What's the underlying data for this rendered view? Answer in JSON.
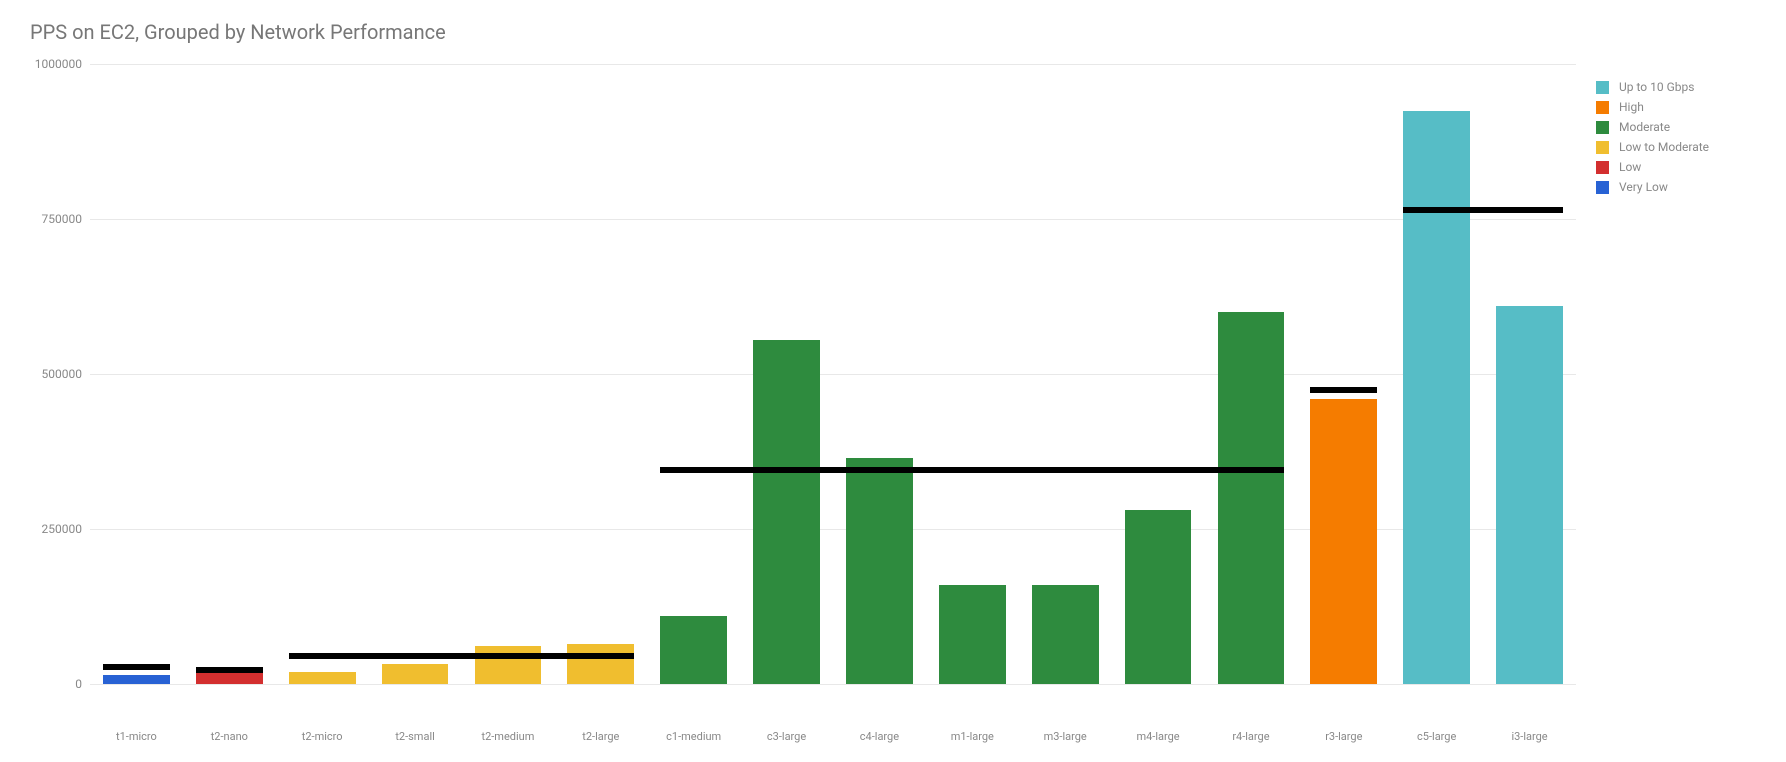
{
  "chart_data": {
    "type": "bar",
    "title": "PPS on EC2, Grouped by Network Performance",
    "ylabel": "",
    "xlabel": "",
    "ylim": [
      0,
      1000000
    ],
    "y_ticks": [
      0,
      250000,
      500000,
      750000,
      1000000
    ],
    "categories": [
      "t1-micro",
      "t2-nano",
      "t2-micro",
      "t2-small",
      "t2-medium",
      "t2-large",
      "c1-medium",
      "c3-large",
      "c4-large",
      "m1-large",
      "m3-large",
      "m4-large",
      "r4-large",
      "r3-large",
      "c5-large",
      "i3-large"
    ],
    "bars": [
      {
        "label": "t1-micro",
        "value": 15000,
        "group": "Very Low"
      },
      {
        "label": "t2-nano",
        "value": 17000,
        "group": "Low"
      },
      {
        "label": "t2-micro",
        "value": 20000,
        "group": "Low to Moderate"
      },
      {
        "label": "t2-small",
        "value": 32000,
        "group": "Low to Moderate"
      },
      {
        "label": "t2-medium",
        "value": 62000,
        "group": "Low to Moderate"
      },
      {
        "label": "t2-large",
        "value": 65000,
        "group": "Low to Moderate"
      },
      {
        "label": "c1-medium",
        "value": 110000,
        "group": "Moderate"
      },
      {
        "label": "c3-large",
        "value": 555000,
        "group": "Moderate"
      },
      {
        "label": "c4-large",
        "value": 365000,
        "group": "Moderate"
      },
      {
        "label": "m1-large",
        "value": 160000,
        "group": "Moderate"
      },
      {
        "label": "m3-large",
        "value": 160000,
        "group": "Moderate"
      },
      {
        "label": "m4-large",
        "value": 280000,
        "group": "Moderate"
      },
      {
        "label": "r4-large",
        "value": 600000,
        "group": "Moderate"
      },
      {
        "label": "r3-large",
        "value": 460000,
        "group": "High"
      },
      {
        "label": "c5-large",
        "value": 925000,
        "group": "Up to 10 Gbps"
      },
      {
        "label": "i3-large",
        "value": 610000,
        "group": "Up to 10 Gbps"
      }
    ],
    "group_averages": [
      {
        "group": "Very Low",
        "avg": 27000,
        "start_idx": 0,
        "end_idx": 0
      },
      {
        "group": "Low",
        "avg": 22000,
        "start_idx": 1,
        "end_idx": 1
      },
      {
        "group": "Low to Moderate",
        "avg": 45000,
        "start_idx": 2,
        "end_idx": 5
      },
      {
        "group": "Moderate",
        "avg": 345000,
        "start_idx": 6,
        "end_idx": 12
      },
      {
        "group": "High",
        "avg": 475000,
        "start_idx": 13,
        "end_idx": 13
      },
      {
        "group": "Up to 10 Gbps",
        "avg": 765000,
        "start_idx": 14,
        "end_idx": 15
      }
    ],
    "legend": [
      {
        "name": "Up to 10 Gbps",
        "color": "#56bdc6"
      },
      {
        "name": "High",
        "color": "#f57c00"
      },
      {
        "name": "Moderate",
        "color": "#2e8b3e"
      },
      {
        "name": "Low to Moderate",
        "color": "#f0be2f"
      },
      {
        "name": "Low",
        "color": "#d32f2f"
      },
      {
        "name": "Very Low",
        "color": "#2862d4"
      }
    ],
    "colors": {
      "Very Low": "#2862d4",
      "Low": "#d32f2f",
      "Low to Moderate": "#f0be2f",
      "Moderate": "#2e8b3e",
      "High": "#f57c00",
      "Up to 10 Gbps": "#56bdc6"
    }
  }
}
